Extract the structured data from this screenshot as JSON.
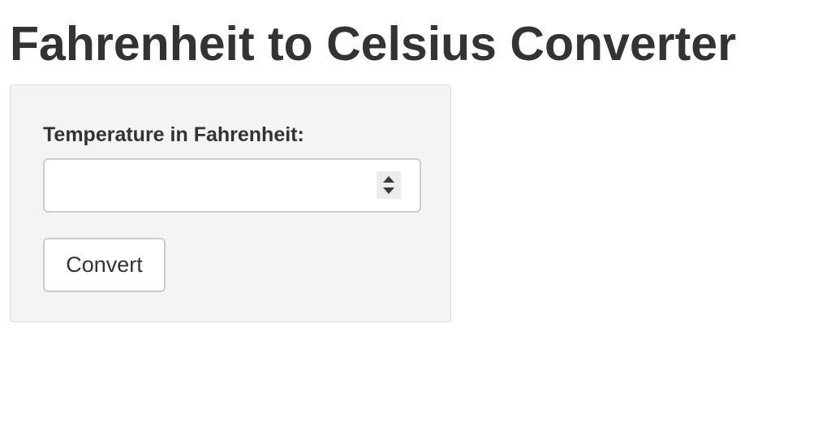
{
  "header": {
    "title": "Fahrenheit to Celsius Converter"
  },
  "form": {
    "temperature_label": "Temperature in Fahrenheit:",
    "temperature_value": "",
    "temperature_placeholder": "",
    "convert_label": "Convert"
  },
  "colors": {
    "panel_background": "#f4f4f4",
    "panel_border": "#dddddd",
    "text": "#333333",
    "input_border": "#cccccc"
  },
  "icons": {
    "spinner_up": "caret-up-icon",
    "spinner_down": "caret-down-icon"
  }
}
